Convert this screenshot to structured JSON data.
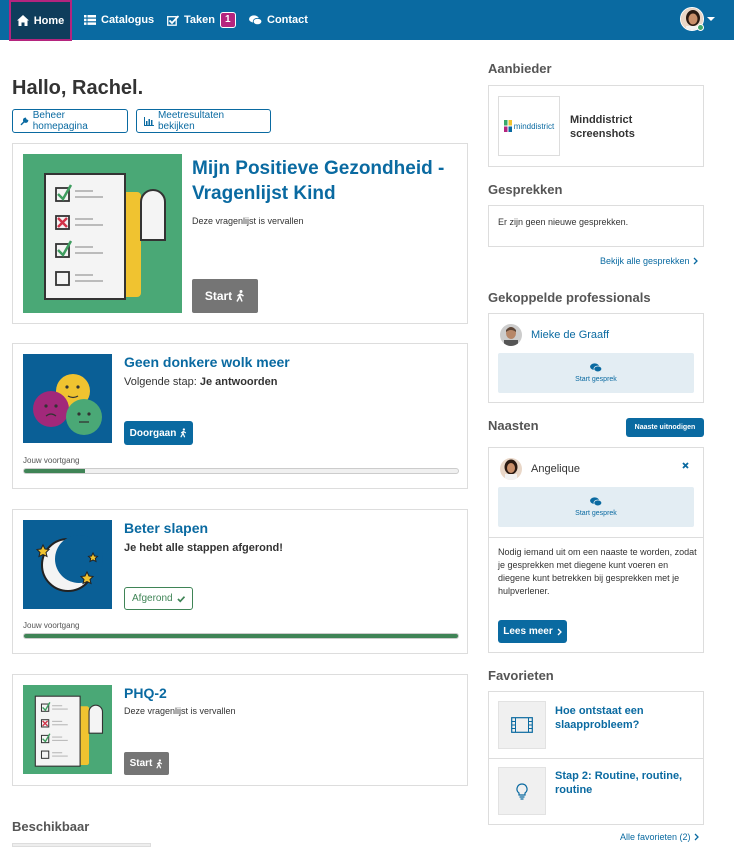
{
  "nav": {
    "home": "Home",
    "catalogue": "Catalogus",
    "tasks": "Taken",
    "tasks_count": "1",
    "contact": "Contact"
  },
  "greeting": "Hallo, Rachel.",
  "buttons": {
    "manage_home": "Beheer homepagina",
    "view_results": "Meetresultaten bekijken"
  },
  "featured": {
    "title": "Mijn Positieve Gezondheid - Vragenlijst Kind",
    "status": "Deze vragenlijst is vervallen",
    "button": "Start"
  },
  "programs": [
    {
      "title": "Geen donkere wolk meer",
      "step_prefix": "Volgende stap: ",
      "step": "Je antwoorden",
      "button": "Doorgaan",
      "progress_label": "Jouw voortgang",
      "progress": 0.14
    },
    {
      "title": "Beter slapen",
      "status": "Je hebt alle stappen afgerond!",
      "button": "Afgerond",
      "progress_label": "Jouw voortgang",
      "progress": 1.0
    },
    {
      "title": "PHQ-2",
      "status": "Deze vragenlijst is vervallen",
      "button": "Start"
    }
  ],
  "available_heading": "Beschikbaar",
  "sidebar": {
    "provider_heading": "Aanbieder",
    "provider_logo_text": "minddistrict",
    "provider_name": "Minddistrict screenshots",
    "conversations_heading": "Gesprekken",
    "conversations_empty": "Er zijn geen nieuwe gesprekken.",
    "conversations_link": "Bekijk alle gesprekken",
    "professionals_heading": "Gekoppelde professionals",
    "professional_name": "Mieke de Graaff",
    "start_conversation": "Start gesprek",
    "relatives_heading": "Naasten",
    "invite_relatives": "Naaste uitnodigen",
    "relative_name": "Angelique",
    "relatives_text": "Nodig iemand uit om een naaste te worden, zodat je gesprekken met diegene kunt voeren en diegene kunt betrekken bij gesprekken met je hulpverlener.",
    "read_more": "Lees meer",
    "favorites_heading": "Favorieten",
    "favorites": [
      {
        "title": "Hoe ontstaat een slaapprobleem?"
      },
      {
        "title": "Stap 2: Routine, routine, routine"
      }
    ],
    "all_favorites": "Alle favorieten (2)"
  },
  "colors": {
    "navbar": "#0a6aa1",
    "accent": "#b5247e",
    "thumb_green": "#4aa876",
    "thumb_blue": "#0a5f96",
    "progress": "#3f8456"
  },
  "icons": [
    "home-icon",
    "list-icon",
    "checkbox-icon",
    "chat-icon",
    "wrench-icon",
    "bar-chart-icon",
    "walk-icon",
    "check-icon",
    "chevron-right-icon",
    "close-icon",
    "film-icon",
    "lightbulb-icon"
  ]
}
